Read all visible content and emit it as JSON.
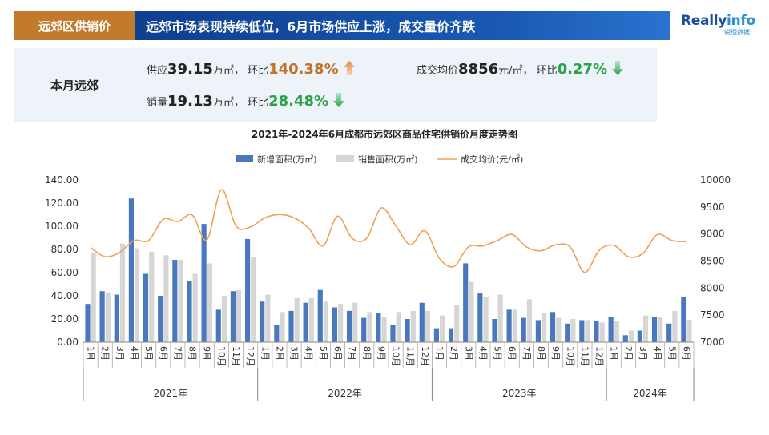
{
  "header": {
    "tag": "远郊区供销价",
    "headline": "远郊市场表现持续低位，6月市场供应上涨，成交量价齐跌"
  },
  "logo": {
    "main_a": "Really",
    "main_b": "info",
    "sub": "锐理数据"
  },
  "summary": {
    "label": "本月远郊",
    "supply": {
      "prefix": "供应",
      "value": "39.15",
      "unit": "万㎡",
      "sep": "，  环比",
      "change": "140.38%",
      "direction": "up"
    },
    "sales": {
      "prefix": "销量",
      "value": "19.13",
      "unit": "万㎡",
      "sep": "，  环比",
      "change": "28.48%",
      "direction": "down"
    },
    "price": {
      "prefix": "成交均价",
      "value": "8856",
      "unit": "元/㎡",
      "sep": "，  环比",
      "change": "0.27%",
      "direction": "down"
    }
  },
  "colors": {
    "bar_new": "#4a78bd",
    "bar_sold": "#d6d6d6",
    "line_price": "#f0a154",
    "up": "#c0722a",
    "down": "#2aa24a"
  },
  "chart_data": {
    "type": "bar",
    "title": "2021年-2024年6月成都市远郊区商品住宅供销价月度走势图",
    "legend_position": "top",
    "categories": [
      "1月",
      "2月",
      "3月",
      "4月",
      "5月",
      "6月",
      "7月",
      "8月",
      "9月",
      "10月",
      "11月",
      "12月",
      "1月",
      "2月",
      "3月",
      "4月",
      "5月",
      "6月",
      "7月",
      "8月",
      "9月",
      "10月",
      "11月",
      "12月",
      "1月",
      "2月",
      "3月",
      "4月",
      "5月",
      "6月",
      "7月",
      "8月",
      "9月",
      "10月",
      "11月",
      "12月",
      "1月",
      "2月",
      "3月",
      "4月",
      "5月",
      "6月"
    ],
    "groups": [
      {
        "label": "2021年",
        "count": 12
      },
      {
        "label": "2022年",
        "count": 12
      },
      {
        "label": "2023年",
        "count": 12
      },
      {
        "label": "2024年",
        "count": 6
      }
    ],
    "series": [
      {
        "name": "新增面积(万㎡)",
        "type": "bar",
        "axis": "left",
        "values": [
          33,
          44,
          41,
          124,
          59,
          40,
          71,
          53,
          102,
          28,
          44,
          89,
          35,
          15,
          27,
          34,
          45,
          30,
          27,
          21,
          25,
          15,
          20,
          34,
          12,
          12,
          68,
          42,
          20,
          28,
          21,
          19,
          26,
          16,
          19,
          18,
          22,
          6,
          10,
          22,
          16,
          39.15
        ]
      },
      {
        "name": "销售面积(万㎡)",
        "type": "bar",
        "axis": "left",
        "values": [
          77,
          43,
          85,
          81,
          78,
          75,
          71,
          59,
          68,
          40,
          45,
          73,
          41,
          26,
          38,
          38,
          35,
          33,
          34,
          26,
          22,
          26,
          27,
          27,
          23,
          32,
          52,
          39,
          41,
          28,
          37,
          25,
          21,
          20,
          19,
          17,
          18,
          10,
          23,
          22,
          27,
          19.13
        ]
      },
      {
        "name": "成交均价(元/㎡)",
        "type": "line",
        "axis": "right",
        "values": [
          8750,
          8580,
          8660,
          8880,
          8880,
          9270,
          9230,
          9350,
          8890,
          9820,
          9150,
          9130,
          9300,
          9360,
          9300,
          9110,
          8780,
          9330,
          8920,
          8920,
          9480,
          9150,
          8800,
          9060,
          8550,
          8400,
          8760,
          8780,
          8880,
          8990,
          8760,
          8690,
          8800,
          8760,
          8290,
          8700,
          8790,
          8580,
          8640,
          8990,
          8880,
          8856
        ]
      }
    ],
    "y_left": {
      "min": 0,
      "max": 140,
      "ticks": [
        "0.00",
        "20.00",
        "40.00",
        "60.00",
        "80.00",
        "100.00",
        "120.00",
        "140.00"
      ]
    },
    "y_right": {
      "min": 7000,
      "max": 10000,
      "ticks": [
        "7000",
        "7500",
        "8000",
        "8500",
        "9000",
        "9500",
        "10000"
      ]
    },
    "grid": false
  }
}
